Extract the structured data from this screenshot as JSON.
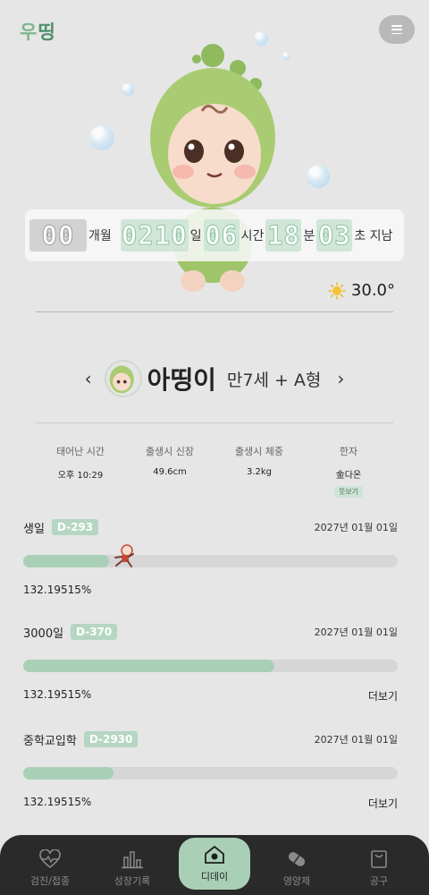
{
  "app": {
    "logo_part1": "우",
    "logo_part2": "띵"
  },
  "timer": {
    "months": "00",
    "months_unit": "개월",
    "days": "0210",
    "days_unit": "일",
    "hours": "06",
    "hours_unit": "시간",
    "minutes": "18",
    "minutes_unit": "분",
    "seconds": "03",
    "seconds_unit": "초 지남"
  },
  "weather": {
    "temperature": "30.0°",
    "icon": "sun-icon"
  },
  "profile": {
    "name": "아띵이",
    "age_blood": "만7세 + A형",
    "prev": "‹",
    "next": "›"
  },
  "birth_info": [
    {
      "label": "태어난 시간",
      "value": "오후 10:29"
    },
    {
      "label": "출생시 신장",
      "value": "49.6cm"
    },
    {
      "label": "출생시 체중",
      "value": "3.2kg"
    },
    {
      "label": "한자",
      "value": "金다온",
      "button": "뜻보기"
    }
  ],
  "ddays": [
    {
      "name": "생일",
      "badge": "D-293",
      "date": "2027년 01월 01일",
      "progress": 0.23,
      "percent": "132.19515%",
      "more": ""
    },
    {
      "name": "3000일",
      "badge": "D-370",
      "date": "2027년 01월 01일",
      "progress": 0.67,
      "percent": "132.19515%",
      "more": "더보기"
    },
    {
      "name": "중학교입학",
      "badge": "D-2930",
      "date": "2027년 01월 01일",
      "progress": 0.24,
      "percent": "132.19515%",
      "more": "더보기"
    }
  ],
  "nav": [
    {
      "label": "검진/접종",
      "icon": "heartbeat-icon"
    },
    {
      "label": "성장기록",
      "icon": "bar-chart-icon"
    },
    {
      "label": "디데이",
      "icon": "home-icon",
      "active": true
    },
    {
      "label": "영양제",
      "icon": "pill-icon"
    },
    {
      "label": "공구",
      "icon": "bag-icon"
    }
  ],
  "colors": {
    "accent": "#a9d0b7",
    "background": "#e6e6e6",
    "nav": "#2a2a2a"
  }
}
